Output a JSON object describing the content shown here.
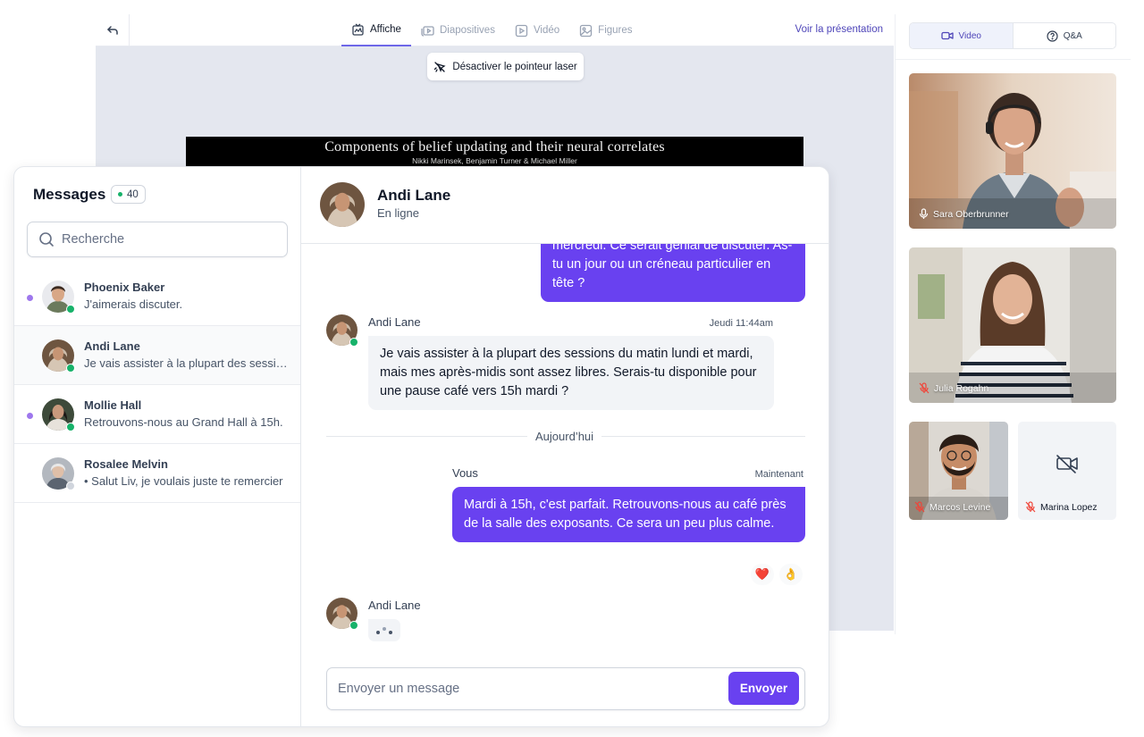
{
  "presentation": {
    "tabs": [
      {
        "label": "Affiche",
        "icon": "poster-icon",
        "active": true
      },
      {
        "label": "Diapositives",
        "icon": "slides-icon",
        "active": false
      },
      {
        "label": "Vidéo",
        "icon": "video-play-icon",
        "active": false
      },
      {
        "label": "Figures",
        "icon": "image-icon",
        "active": false
      }
    ],
    "view_link": "Voir la présentation",
    "laser_button": "Désactiver le pointeur laser",
    "slide": {
      "title": "Components of belief updating and their neural correlates",
      "authors": "Nikki Marinsek, Benjamin Turner & Michael Miller"
    }
  },
  "video_panel": {
    "tabs": [
      {
        "label": "Video",
        "icon": "video-camera-icon",
        "active": true
      },
      {
        "label": "Q&A",
        "icon": "question-circle-icon",
        "active": false
      }
    ],
    "participants": [
      {
        "name": "Sara Oberbrunner",
        "mic": "on",
        "camera": "on"
      },
      {
        "name": "Julia Rogahn",
        "mic": "muted",
        "camera": "on"
      },
      {
        "name": "Marcos Levine",
        "mic": "muted",
        "camera": "on"
      },
      {
        "name": "Marina Lopez",
        "mic": "muted",
        "camera": "off"
      }
    ]
  },
  "messages": {
    "title": "Messages",
    "count": "40",
    "search_placeholder": "Recherche",
    "conversations": [
      {
        "name": "Phoenix Baker",
        "preview": "J'aimerais discuter.",
        "unread": true,
        "online": true
      },
      {
        "name": "Andi Lane",
        "preview": "Je vais assister à la plupart des sessions du matin lundi et mardi",
        "unread": false,
        "online": true,
        "selected": true
      },
      {
        "name": "Mollie Hall",
        "preview": "Retrouvons-nous au Grand Hall à 15h.",
        "unread": true,
        "online": true
      },
      {
        "name": "Rosalee Melvin",
        "preview": "• Salut Liv, je voulais juste te remercier",
        "unread": false,
        "online": false
      }
    ]
  },
  "chat": {
    "contact_name": "Andi Lane",
    "contact_status": "En ligne",
    "messages": [
      {
        "from": "me",
        "text": "mercredi. Ce serait génial de discuter. As-tu un jour ou un créneau particulier en tête ?"
      },
      {
        "from": "Andi Lane",
        "time": "Jeudi 11:44am",
        "text": "Je vais assister à la plupart des sessions du matin lundi et mardi, mais mes après-midis sont assez libres. Serais-tu disponible pour une pause café vers 15h mardi ?"
      },
      {
        "from": "Vous",
        "time": "Maintenant",
        "text": "Mardi à 15h, c'est parfait. Retrouvons-nous au café près de la salle des exposants. Ce sera un peu plus calme."
      }
    ],
    "divider": "Aujourd’hui",
    "reactions": [
      "❤️",
      "👌"
    ],
    "typing_from": "Andi Lane",
    "input_placeholder": "Envoyer un message",
    "send_label": "Envoyer"
  },
  "colors": {
    "accent": "#6941f0",
    "online": "#17b26a",
    "unread_dot": "#9e77ed",
    "muted_mic": "#f04438"
  }
}
